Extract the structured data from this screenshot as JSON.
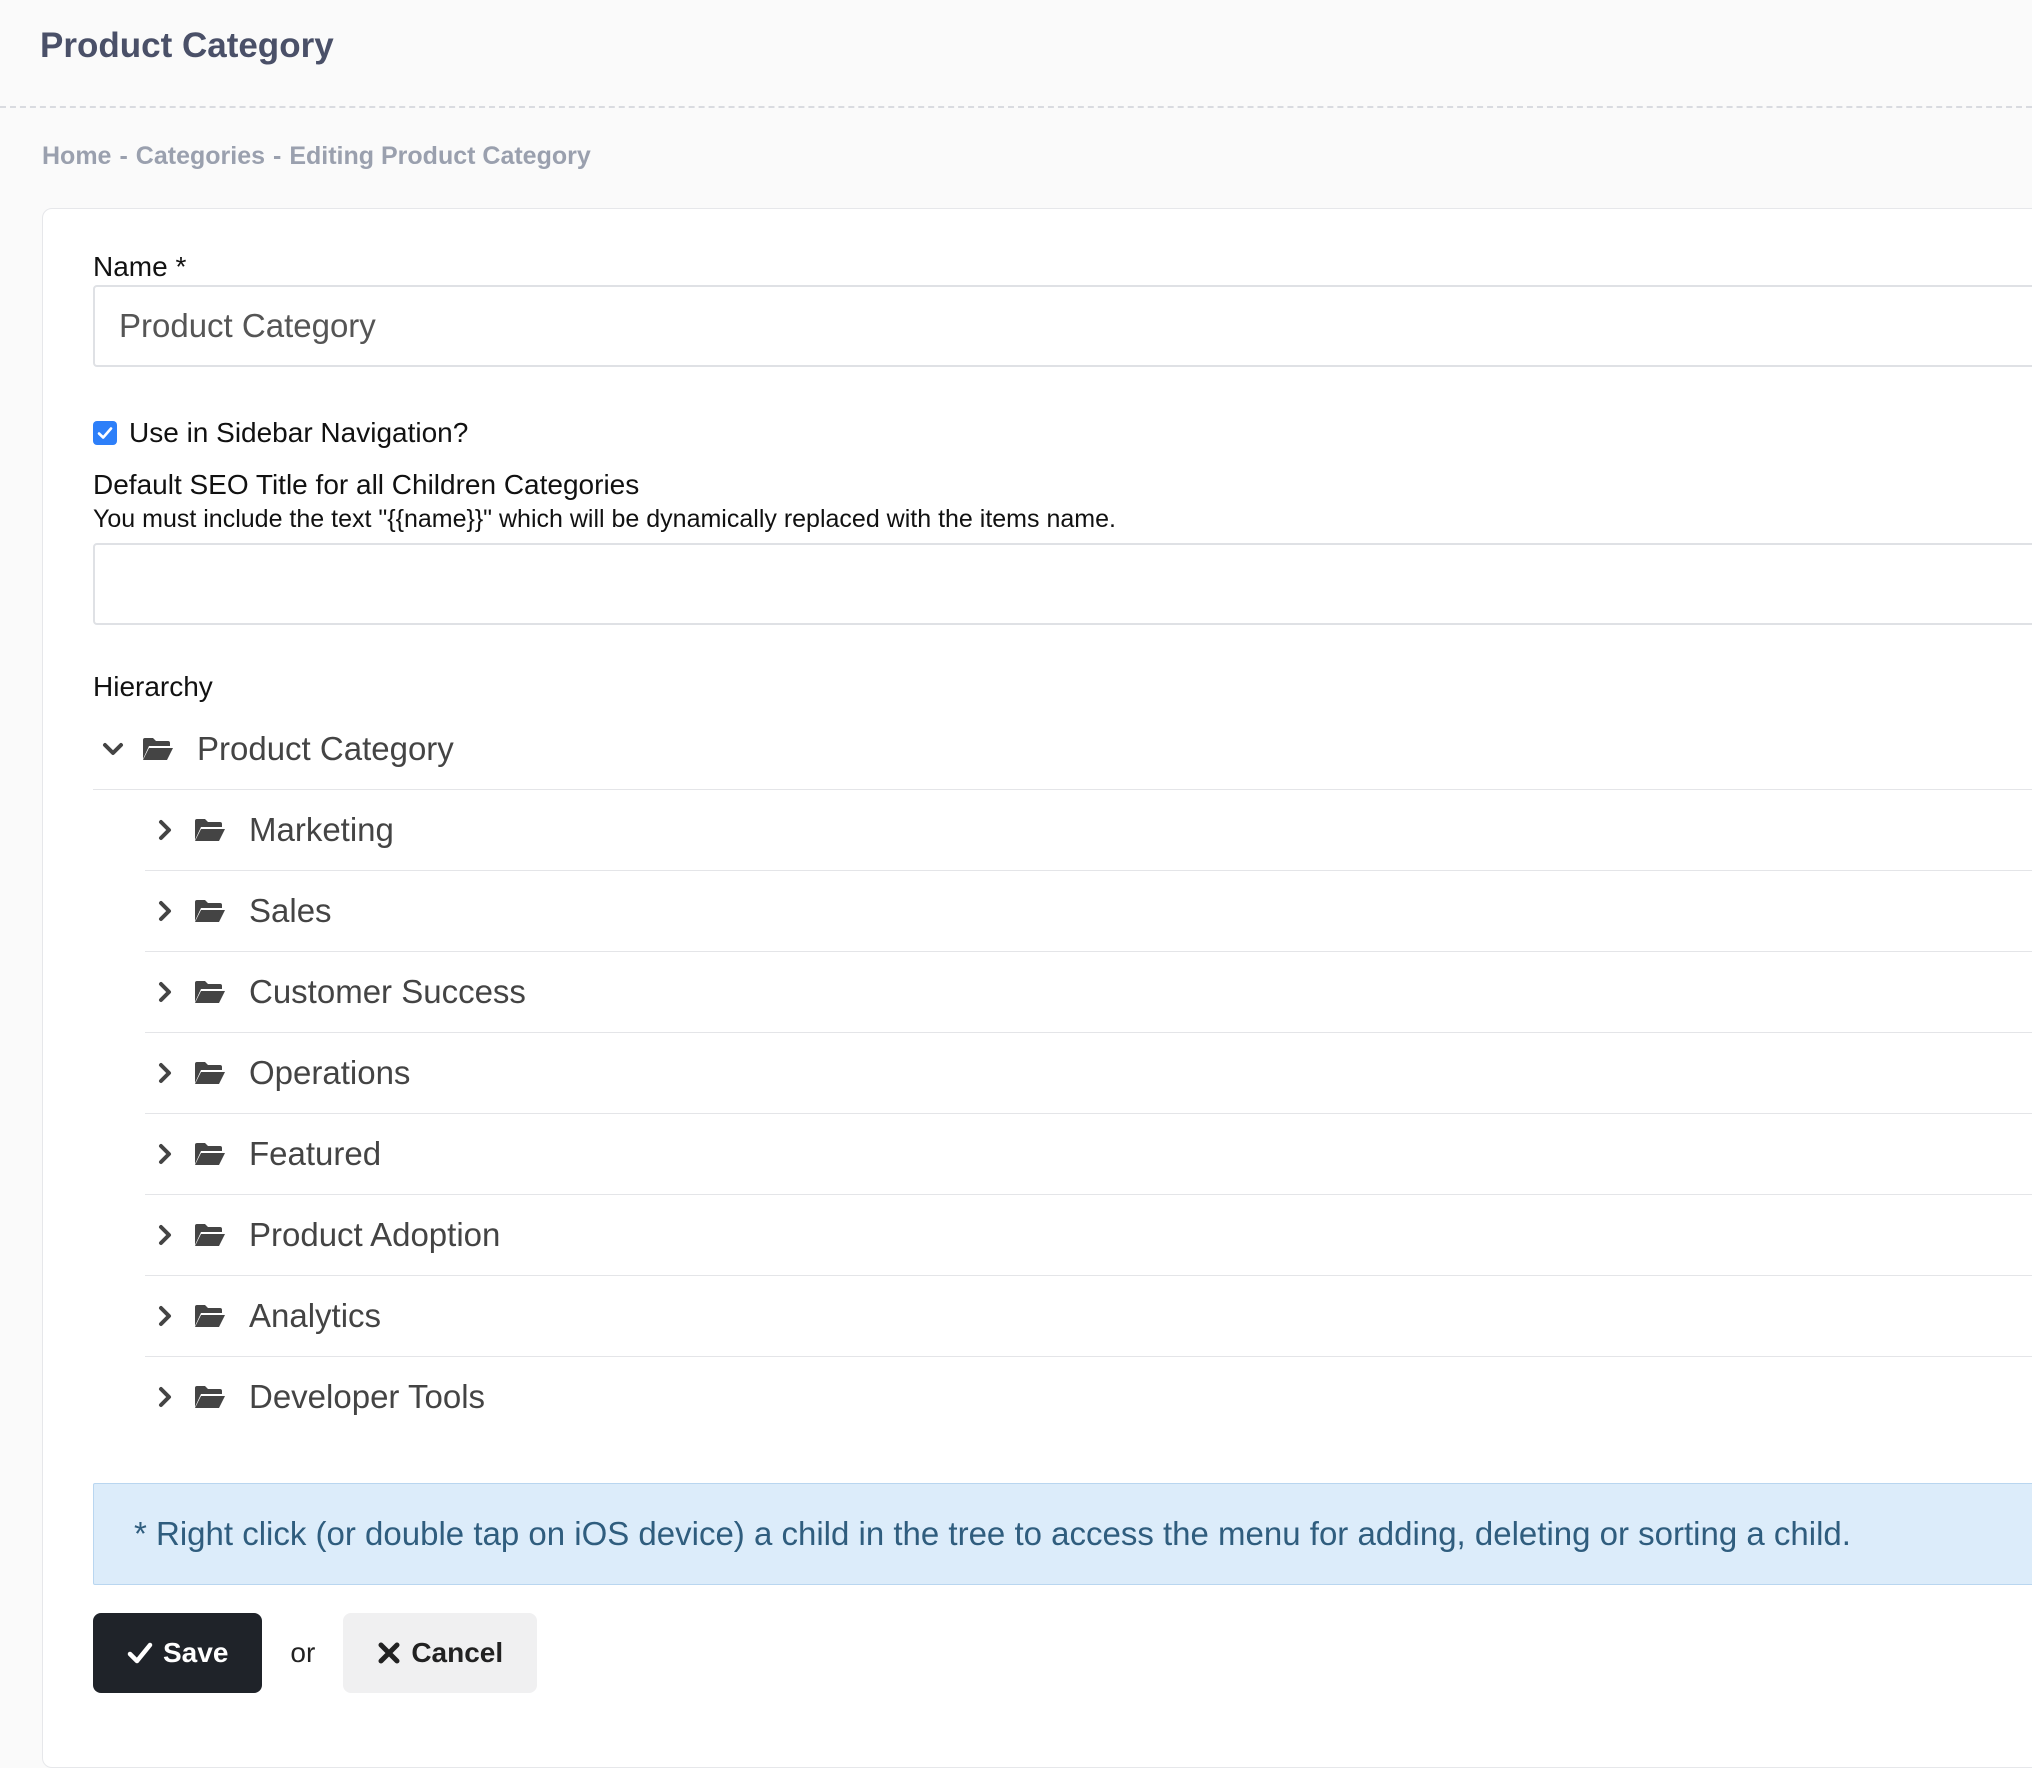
{
  "page": {
    "title": "Product Category"
  },
  "breadcrumb": {
    "items": [
      "Home",
      "Categories",
      "Editing Product Category"
    ],
    "separator": "-"
  },
  "form": {
    "name": {
      "label": "Name *",
      "value": "Product Category"
    },
    "sidebar_nav": {
      "label": "Use in Sidebar Navigation?",
      "checked": true
    },
    "seo_title": {
      "label": "Default SEO Title for all Children Categories",
      "help": "You must include the text \"{{name}}\" which will be dynamically replaced with the items name.",
      "value": ""
    },
    "hierarchy": {
      "label": "Hierarchy",
      "root": {
        "label": "Product Category",
        "expanded": true
      },
      "children": [
        "Marketing",
        "Sales",
        "Customer Success",
        "Operations",
        "Featured",
        "Product Adoption",
        "Analytics",
        "Developer Tools"
      ]
    },
    "info": "* Right click (or double tap on iOS device) a child in the tree to access the menu for adding, deleting or sorting a child."
  },
  "actions": {
    "save_label": "Save",
    "or_label": "or",
    "cancel_label": "Cancel"
  },
  "icons": {
    "tree_expanded": "chevron-down-icon",
    "tree_collapsed": "chevron-right-icon",
    "folder": "folder-open-icon",
    "save": "check-icon",
    "cancel": "close-icon",
    "checkbox": "check-icon"
  },
  "colors": {
    "checkbox_accent": "#2d7ff9",
    "save_button_bg": "#1f2329",
    "info_bg": "#dcecfa",
    "info_text": "#2f5d7e",
    "title": "#4a5068",
    "breadcrumb": "#9aa0ae"
  }
}
